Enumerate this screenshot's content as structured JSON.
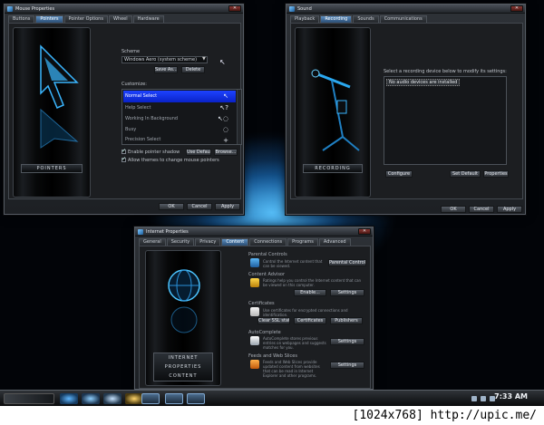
{
  "mouse_window": {
    "title": "Mouse Properties",
    "tabs": [
      "Buttons",
      "Pointers",
      "Pointer Options",
      "Wheel",
      "Hardware"
    ],
    "active_tab": 1,
    "art_label": "POINTERS",
    "scheme_label": "Scheme",
    "scheme_value": "Windows Aero (system scheme)",
    "save_as_label": "Save As...",
    "delete_label": "Delete",
    "customize_label": "Customize:",
    "pointer_rows": [
      {
        "label": "Normal Select",
        "cursor": "↖",
        "selected": true
      },
      {
        "label": "Help Select",
        "cursor": "↖?",
        "selected": false
      },
      {
        "label": "Working In Background",
        "cursor": "↖◌",
        "selected": false
      },
      {
        "label": "Busy",
        "cursor": "◌",
        "selected": false
      },
      {
        "label": "Precision Select",
        "cursor": "+",
        "selected": false
      }
    ],
    "enable_shadow_label": "Enable pointer shadow",
    "allow_themes_label": "Allow themes to change mouse pointers",
    "use_default_label": "Use Default",
    "browse_label": "Browse...",
    "ok_label": "OK",
    "cancel_label": "Cancel",
    "apply_label": "Apply"
  },
  "sound_window": {
    "title": "Sound",
    "tabs": [
      "Playback",
      "Recording",
      "Sounds",
      "Communications"
    ],
    "active_tab": 1,
    "art_label": "RECORDING",
    "instruction": "Select a recording device below to modify its settings:",
    "empty_message": "No audio devices are installed",
    "configure_label": "Configure",
    "set_default_label": "Set Default",
    "properties_label": "Properties",
    "ok_label": "OK",
    "cancel_label": "Cancel",
    "apply_label": "Apply"
  },
  "internet_window": {
    "title": "Internet Properties",
    "tabs": [
      "General",
      "Security",
      "Privacy",
      "Content",
      "Connections",
      "Programs",
      "Advanced"
    ],
    "active_tab": 3,
    "art_label_lines": [
      "INTERNET",
      "PROPERTIES",
      "CONTENT"
    ],
    "sections": [
      {
        "title": "Parental Controls",
        "desc": "Control the Internet content that can be viewed.",
        "buttons": [
          "Parental Controls"
        ]
      },
      {
        "title": "Content Advisor",
        "desc": "Ratings help you control the Internet content that can be viewed on this computer.",
        "buttons": [
          "Enable...",
          "Settings"
        ]
      },
      {
        "title": "Certificates",
        "desc": "Use certificates for encrypted connections and identification.",
        "buttons": [
          "Clear SSL state",
          "Certificates",
          "Publishers"
        ]
      },
      {
        "title": "AutoComplete",
        "desc": "AutoComplete stores previous entries on webpages and suggests matches for you.",
        "buttons": [
          "Settings"
        ]
      },
      {
        "title": "Feeds and Web Slices",
        "desc": "Feeds and Web Slices provide updated content from websites that can be read in Internet Explorer and other programs.",
        "buttons": [
          "Settings"
        ]
      }
    ]
  },
  "taskbar": {
    "clock": "7:33 AM"
  },
  "caption": "[1024x768] http://upic.me/",
  "colors": {
    "selection": "#1d42ff",
    "accent_glow": "#2a9fe8"
  }
}
